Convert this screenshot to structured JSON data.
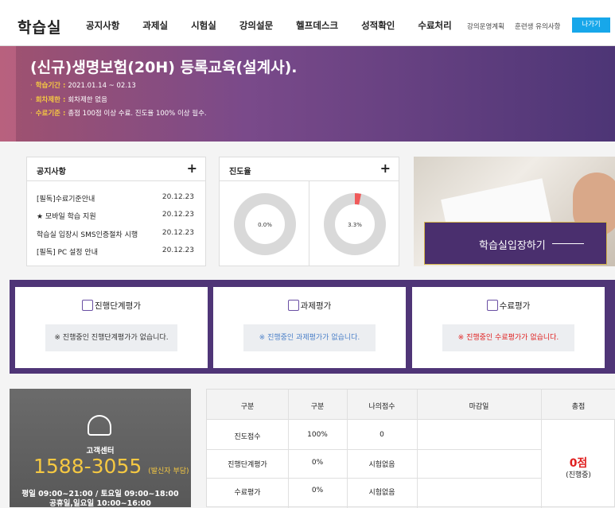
{
  "header": {
    "logo": "학습실",
    "nav": [
      "공지사항",
      "과제실",
      "시험실",
      "강의설문",
      "헬프데스크",
      "성적확인",
      "수료처리"
    ],
    "sub_links": [
      "강의운영계획",
      "훈련생 유의사항"
    ],
    "exit_label": "나가기"
  },
  "course": {
    "title": "(신규)생명보험(20H) 등록교육(설계사).",
    "info": [
      {
        "key": "학습기간",
        "value": "2021.01.14 ~ 02.13"
      },
      {
        "key": "회차제한",
        "value": "회차제한 없음"
      },
      {
        "key": "수료기준",
        "value": "총점 100점 이상 수료. 진도율 100% 이상 필수."
      }
    ]
  },
  "notices": {
    "title": "공지사항",
    "plus": "+",
    "items": [
      {
        "title": "[필독]수료기준안내",
        "date": "20.12.23"
      },
      {
        "title": "★ 모바일 학습 지원",
        "date": "20.12.23"
      },
      {
        "title": "학습실 입장시 SMS인증절차 시행",
        "date": "20.12.23"
      },
      {
        "title": "[필독] PC 설정 안내",
        "date": "20.12.23"
      }
    ]
  },
  "progress": {
    "title": "진도율",
    "plus": "+",
    "donuts": [
      {
        "label": "0.0%",
        "value": 0.0,
        "color": "#f05a5a"
      },
      {
        "label": "3.3%",
        "value": 3.3,
        "color": "#f05a5a"
      }
    ]
  },
  "enter": {
    "label": "학습실입장하기"
  },
  "evaluations": [
    {
      "title": "진행단계평가",
      "message": "※ 진행중인 진행단계평가가 없습니다.",
      "color": "#333333"
    },
    {
      "title": "과제평가",
      "message": "※ 진행중인 과제평가가 없습니다.",
      "color": "#4a7fc8"
    },
    {
      "title": "수료평가",
      "message": "※ 진행중인 수료평가가 없습니다.",
      "color": "#e02020"
    }
  ],
  "callcenter": {
    "label": "고객센터",
    "phone": "1588-3055",
    "note": "(발신자 부담)",
    "hours1": "평일 09:00~21:00 / 토요일 09:00~18:00",
    "hours2": "공휴일,일요일 10:00~16:00"
  },
  "scores": {
    "headers": [
      "구분",
      "구분",
      "나의점수",
      "마감일",
      "총점"
    ],
    "rows": [
      [
        "진도점수",
        "100%",
        "0",
        ""
      ],
      [
        "진행단계평가",
        "0%",
        "시험없음",
        ""
      ],
      [
        "수료평가",
        "0%",
        "시험없음",
        ""
      ]
    ],
    "total": "0점",
    "status": "(진행중)"
  }
}
